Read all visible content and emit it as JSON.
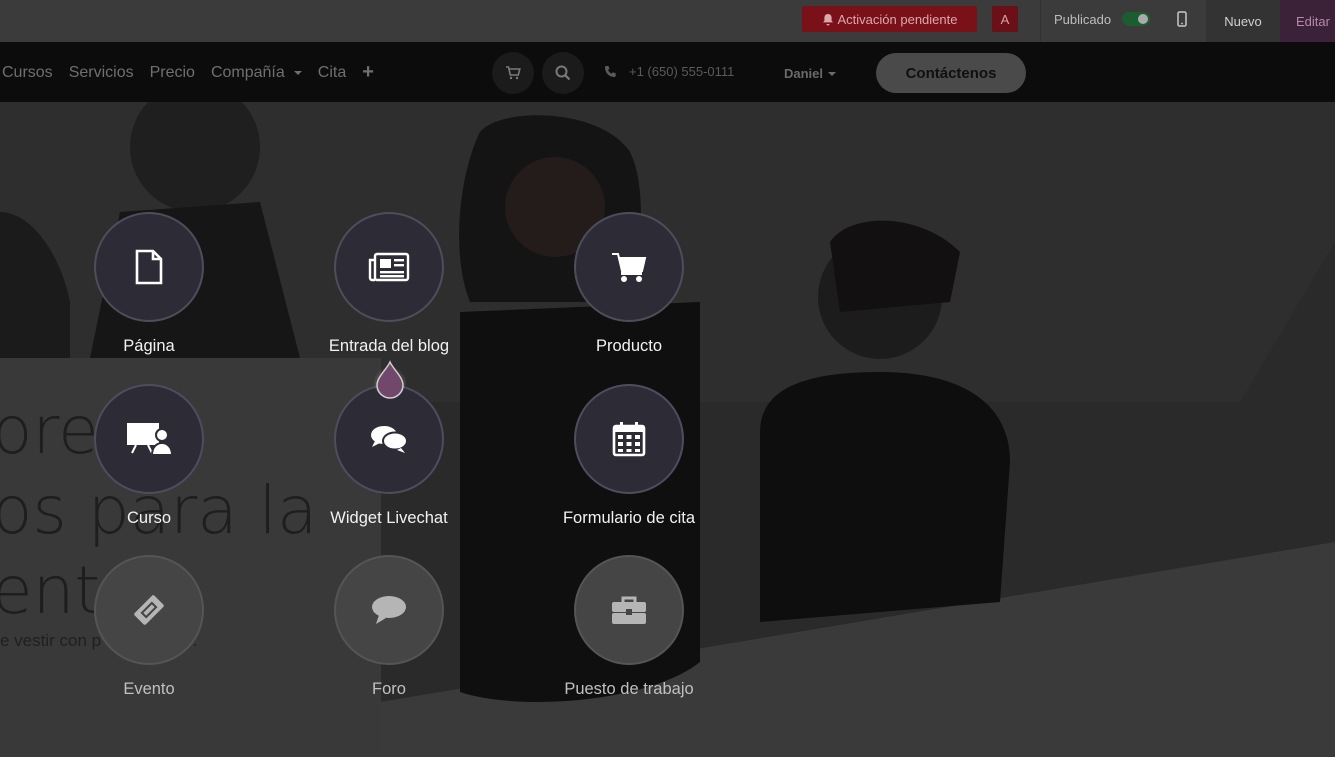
{
  "topbar": {
    "activation_label": "Activación pendiente",
    "avatar_letter": "A",
    "published_label": "Publicado",
    "new_label": "Nuevo",
    "edit_label": "Editar"
  },
  "nav": {
    "links": [
      "Cursos",
      "Servicios",
      "Precio",
      "Compañía",
      "Cita"
    ],
    "phone": "+1 (650) 555-0111",
    "user": "Daniel",
    "contact_label": "Contáctenos"
  },
  "hero": {
    "line1": "ores",
    "line2": "os para la",
    "line3": "entes",
    "subtitle": "e vestir con p          s elegantes."
  },
  "options": [
    {
      "label": "Página",
      "icon": "file-icon",
      "enabled": true
    },
    {
      "label": "Entrada del blog",
      "icon": "newspaper-icon",
      "enabled": true
    },
    {
      "label": "Producto",
      "icon": "cart-icon",
      "enabled": true
    },
    {
      "label": "Curso",
      "icon": "presentation-icon",
      "enabled": true
    },
    {
      "label": "Widget Livechat",
      "icon": "chat-bubbles-icon",
      "enabled": true
    },
    {
      "label": "Formulario de cita",
      "icon": "calendar-icon",
      "enabled": true
    },
    {
      "label": "Evento",
      "icon": "ticket-icon",
      "enabled": false
    },
    {
      "label": "Foro",
      "icon": "comment-icon",
      "enabled": false
    },
    {
      "label": "Puesto de trabajo",
      "icon": "briefcase-icon",
      "enabled": false
    }
  ],
  "colors": {
    "activation_bg": "#7a1018",
    "toggle_on": "#1c5c31",
    "edit_bg": "#3c2238",
    "brand_drop": "#71476b"
  }
}
